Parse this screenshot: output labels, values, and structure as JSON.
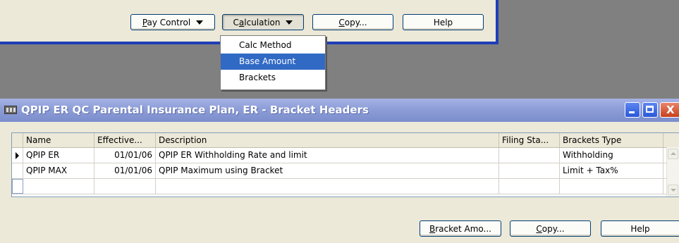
{
  "top_window": {
    "buttons": {
      "pay_control_prefix": "",
      "pay_control_underlined": "P",
      "pay_control_rest": "ay Control",
      "calculation_prefix": "C",
      "calculation_underlined": "a",
      "calculation_rest": "lculation",
      "copy_prefix": "",
      "copy_underlined": "C",
      "copy_rest": "opy...",
      "help": "Help"
    }
  },
  "dropdown_menu": {
    "items": [
      {
        "label": "Calc Method",
        "active": false
      },
      {
        "label": "Base Amount",
        "active": true
      },
      {
        "label": "Brackets",
        "active": false
      }
    ]
  },
  "main_window": {
    "title": "QPIP ER QC Parental Insurance Plan, ER - Bracket Headers",
    "grid": {
      "headers": [
        "Name",
        "Effective...",
        "Description",
        "Filing Sta...",
        "Brackets Type"
      ],
      "rows": [
        {
          "name": "QPIP ER",
          "effective": "01/01/06",
          "description": "QPIP ER Withholding Rate and limit",
          "filing_status": "",
          "brackets_type": "Withholding"
        },
        {
          "name": "QPIP MAX",
          "effective": "01/01/06",
          "description": "QPIP Maximum using Bracket",
          "filing_status": "",
          "brackets_type": "Limit + Tax%"
        }
      ]
    },
    "buttons": {
      "bracket_underlined": "B",
      "bracket_rest": "racket Amo...",
      "copy_underlined": "C",
      "copy_rest": "opy...",
      "help": "Help"
    }
  },
  "colors": {
    "window_face": "#ece9d8",
    "frame_blue": "#1f3fb8",
    "menu_highlight": "#316ac5",
    "inactive_titlebar": "#8f9fd8"
  }
}
